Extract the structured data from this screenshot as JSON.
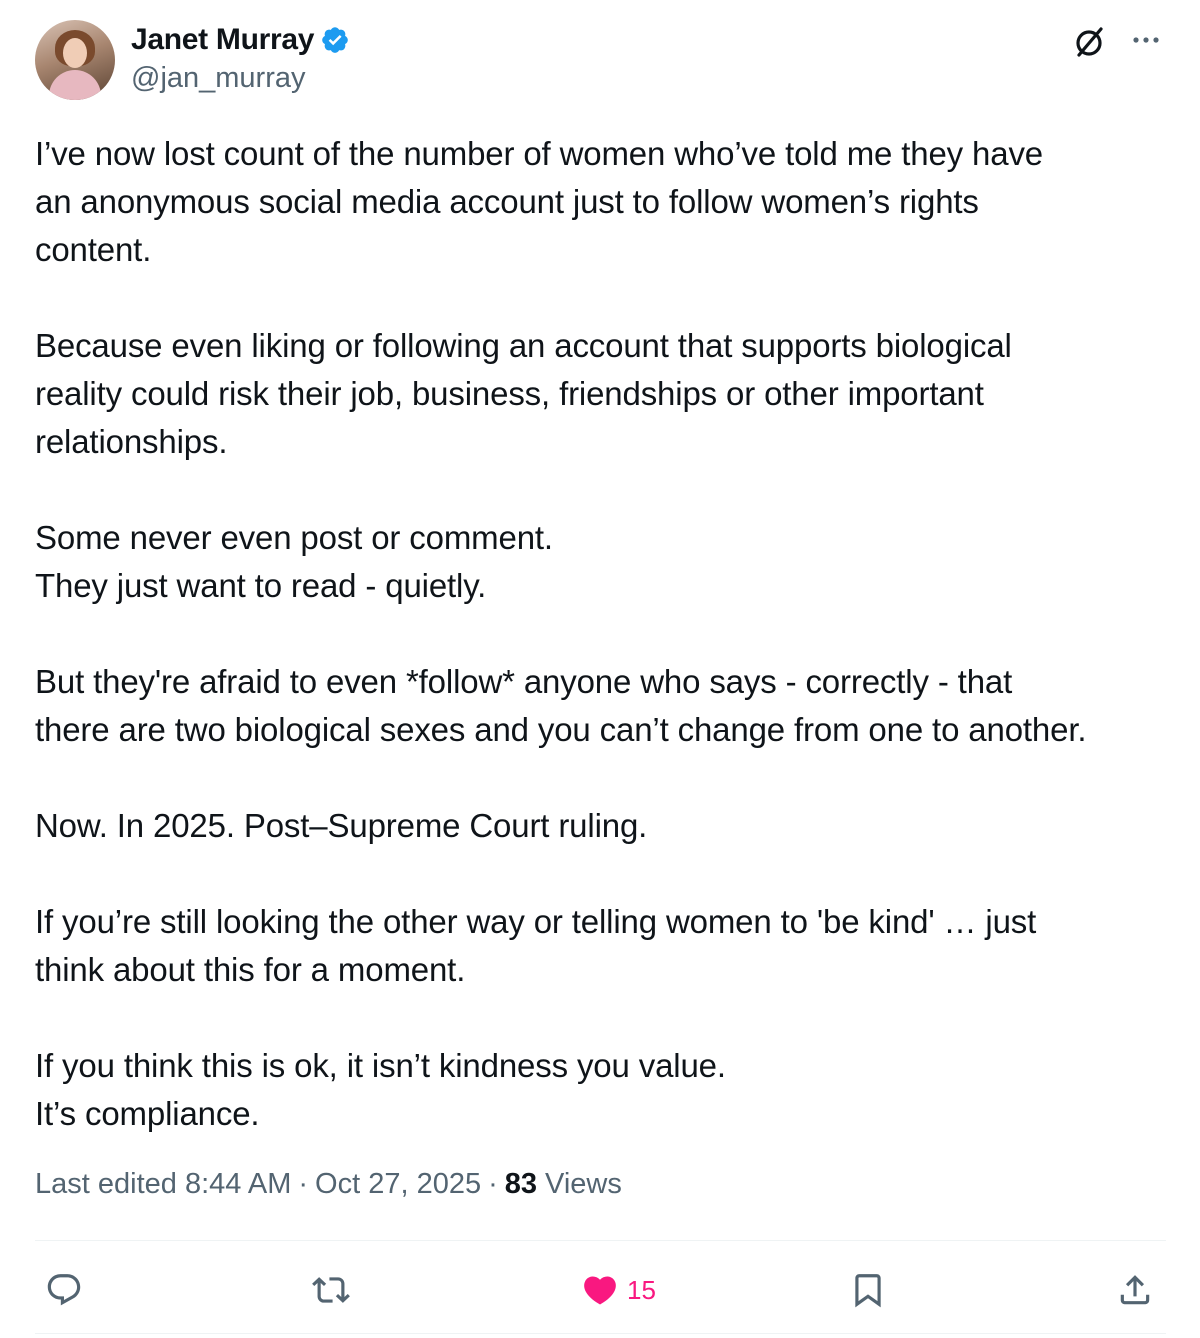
{
  "author": {
    "display_name": "Janet Murray",
    "handle": "@jan_murray",
    "verified": true,
    "avatar": "profile-photo"
  },
  "icons": {
    "verified_badge": "verified-badge-icon",
    "grok": "grok-icon",
    "more": "more-options-icon",
    "reply": "reply-icon",
    "retweet": "retweet-icon",
    "like": "heart-icon",
    "bookmark": "bookmark-icon",
    "share": "share-icon"
  },
  "body": {
    "p1": {
      "l1": "I’ve now lost count of the number of women who’ve told me they have",
      "l2": "an anonymous social media account just to follow women’s rights",
      "l3": "content."
    },
    "p2": {
      "l1": "Because even liking or following an account that supports biological",
      "l2": "reality could risk their job, business, friendships or other important",
      "l3": "relationships."
    },
    "p3": {
      "l1": "Some never even post or comment.",
      "l2": "They just want to read - quietly."
    },
    "p4": {
      "l1": "But they're afraid to even *follow* anyone who says - correctly - that",
      "l2": "there are two biological sexes and you can’t change from one to another."
    },
    "p5": {
      "l1": "Now. In 2025. Post–Supreme Court ruling."
    },
    "p6": {
      "l1": "If you’re still looking the other way or telling women to 'be kind' … just",
      "l2": "think about this for a moment."
    },
    "p7": {
      "l1": "If you think this is ok, it isn’t kindness you value.",
      "l2": "It’s compliance."
    }
  },
  "meta": {
    "edited_label": "Last edited",
    "time": "8:44 AM",
    "date": "Oct 27, 2025",
    "separator": "·",
    "views_count": "83",
    "views_label": "Views"
  },
  "actions": {
    "like_count": "15",
    "liked": true
  },
  "colors": {
    "text": "#0f1419",
    "secondary": "#536471",
    "verified": "#1d9bf0",
    "like": "#f91880",
    "divider": "#eff3f4"
  }
}
